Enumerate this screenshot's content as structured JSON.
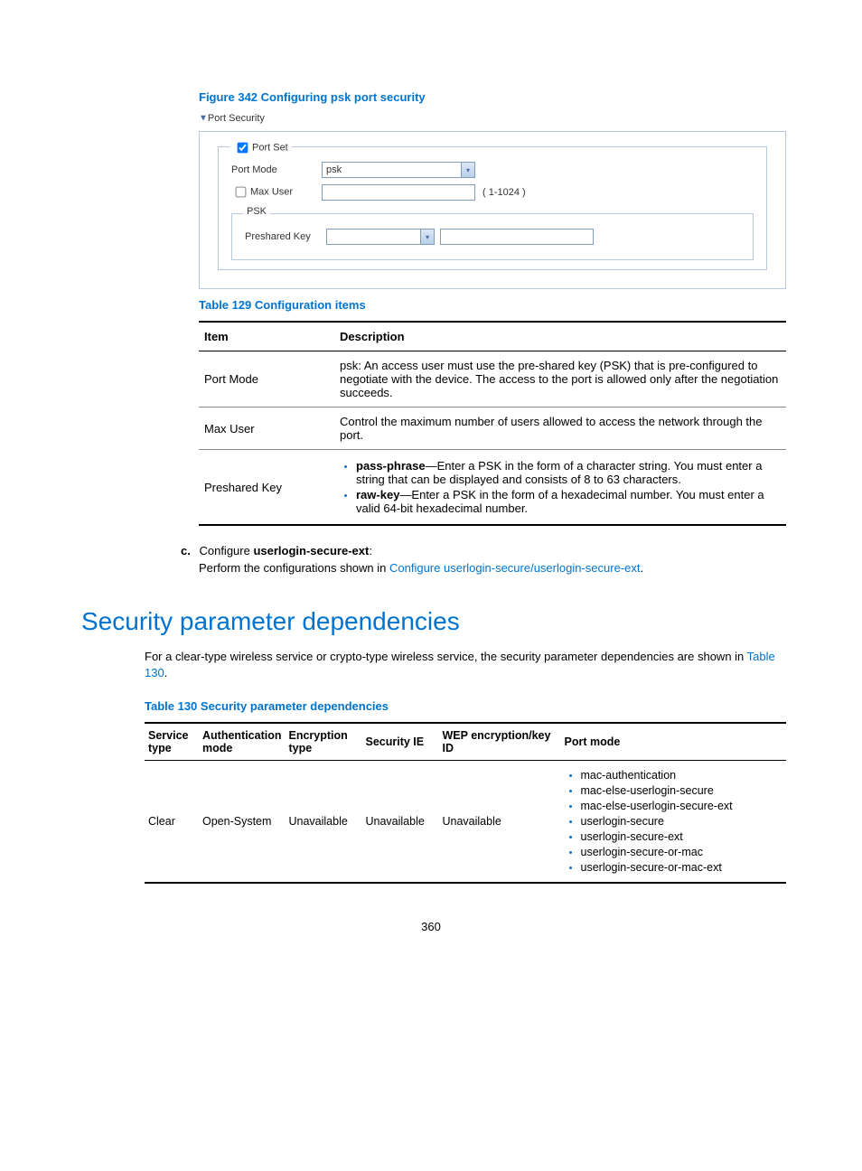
{
  "figure342": {
    "caption": "Figure 342 Configuring psk port security",
    "ui": {
      "collapser": "Port Security",
      "portset_legend": "Port Set",
      "port_mode_label": "Port Mode",
      "port_mode_value": "psk",
      "max_user_label": "Max User",
      "max_user_hint": "( 1-1024 )",
      "psk_legend": "PSK",
      "preshared_key_label": "Preshared Key"
    }
  },
  "table129": {
    "caption": "Table 129 Configuration items",
    "headers": {
      "item": "Item",
      "desc": "Description"
    },
    "rows": {
      "port_mode": {
        "item": "Port Mode",
        "desc": "psk: An access user must use the pre-shared key (PSK) that is pre-configured to negotiate with the device. The access to the port is allowed only after the negotiation succeeds."
      },
      "max_user": {
        "item": "Max User",
        "desc": "Control the maximum number of users allowed to access the network through the port."
      },
      "preshared": {
        "item": "Preshared Key",
        "pass_label": "pass-phrase",
        "pass_text": "—Enter a PSK in the form of a character string. You must enter a string that can be displayed and consists of 8 to 63 characters.",
        "raw_label": "raw-key",
        "raw_text": "—Enter a PSK in the form of a hexadecimal number. You must enter a valid 64-bit hexadecimal number."
      }
    }
  },
  "step_c": {
    "letter": "c.",
    "lead": "Configure ",
    "bold": "userlogin-secure-ext",
    "colon": ":",
    "body_prefix": "Perform the configurations shown in ",
    "body_link": "Configure userlogin-secure/userlogin-secure-ext",
    "body_suffix": "."
  },
  "section": {
    "title": "Security parameter dependencies",
    "para_prefix": "For a clear-type wireless service or crypto-type wireless service, the security parameter dependencies are shown in ",
    "para_link": "Table 130",
    "para_suffix": "."
  },
  "table130": {
    "caption": "Table 130 Security parameter dependencies",
    "headers": {
      "service": "Service type",
      "auth": "Authentication mode",
      "enc": "Encryption type",
      "secie": "Security IE",
      "wep": "WEP encryption/key ID",
      "port": "Port mode"
    },
    "row1": {
      "service": "Clear",
      "auth": "Open-System",
      "enc": "Unavailable",
      "secie": "Unavailable",
      "wep": "Unavailable",
      "modes": [
        "mac-authentication",
        "mac-else-userlogin-secure",
        "mac-else-userlogin-secure-ext",
        "userlogin-secure",
        "userlogin-secure-ext",
        "userlogin-secure-or-mac",
        "userlogin-secure-or-mac-ext"
      ]
    }
  },
  "page_number": "360"
}
